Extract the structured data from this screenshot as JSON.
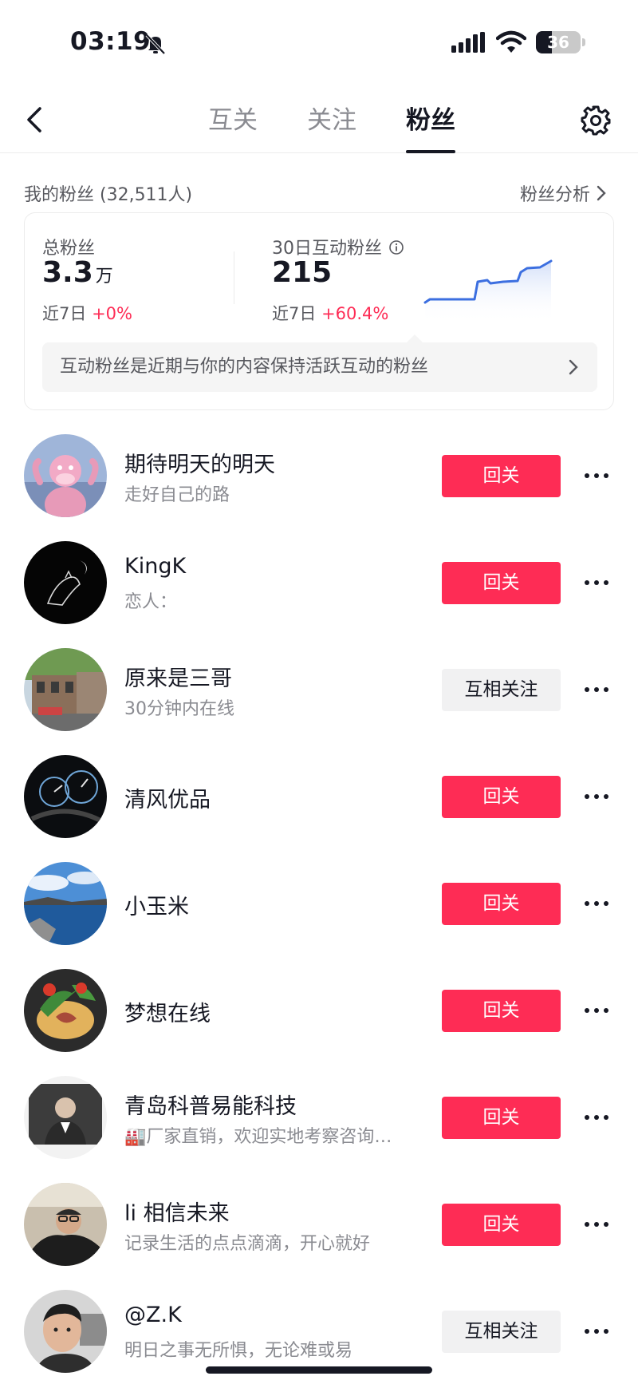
{
  "status_bar": {
    "time": "03:19",
    "battery": "36",
    "battery_level": 0.36
  },
  "nav": {
    "tabs": [
      {
        "label": "互关",
        "active": false
      },
      {
        "label": "关注",
        "active": false
      },
      {
        "label": "粉丝",
        "active": true
      }
    ]
  },
  "fans_header": {
    "count_label": "我的粉丝 (32,511人)",
    "analysis_label": "粉丝分析"
  },
  "stats": {
    "total": {
      "label": "总粉丝",
      "value": "3.3",
      "unit": "万",
      "change_prefix": "近7日",
      "change": "+0%"
    },
    "active": {
      "label": "30日互动粉丝",
      "value": "215",
      "change_prefix": "近7日",
      "change": "+60.4%"
    },
    "tip": "互动粉丝是近期与你的内容保持活跃互动的粉丝"
  },
  "followers": [
    {
      "name": "期待明天的明天",
      "bio": "走好自己的路",
      "button": "回关",
      "mutual": false,
      "avatar": "pink-panther-avatar"
    },
    {
      "name": "KingK",
      "bio": "恋人：",
      "button": "回关",
      "mutual": false,
      "avatar": "dark-cat-avatar"
    },
    {
      "name": "原来是三哥",
      "bio": "30分钟内在线",
      "button": "互相关注",
      "mutual": true,
      "avatar": "street-avatar"
    },
    {
      "name": "清风优品",
      "bio": "",
      "button": "回关",
      "mutual": false,
      "avatar": "dashboard-avatar"
    },
    {
      "name": "小玉米",
      "bio": "",
      "button": "回关",
      "mutual": false,
      "avatar": "lake-avatar"
    },
    {
      "name": "梦想在线",
      "bio": "",
      "button": "回关",
      "mutual": false,
      "avatar": "food-avatar"
    },
    {
      "name": "青岛科普易能科技",
      "bio": "🏭厂家直销，欢迎实地考察咨询…",
      "button": "回关",
      "mutual": false,
      "avatar": "business-man-avatar"
    },
    {
      "name": "li 相信未来",
      "bio": "记录生活的点点滴滴，开心就好",
      "button": "回关",
      "mutual": false,
      "avatar": "car-selfie-avatar"
    },
    {
      "name": "@Z.K",
      "bio": "明日之事无所惧，无论难或易",
      "button": "互相关注",
      "mutual": true,
      "avatar": "boy-avatar"
    }
  ]
}
